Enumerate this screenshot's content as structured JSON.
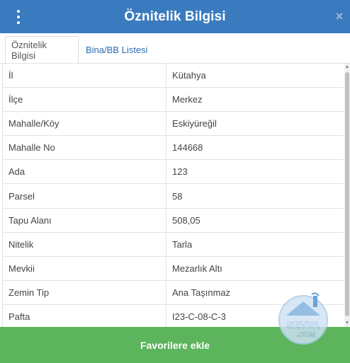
{
  "header": {
    "title": "Öznitelik Bilgisi",
    "menu_icon": "kebab-menu-icon",
    "close_icon": "close-icon",
    "close_glyph": "×"
  },
  "tabs": [
    {
      "label": "Öznitelik Bilgisi",
      "active": true
    },
    {
      "label": "Bina/BB Listesi",
      "active": false
    }
  ],
  "attributes": [
    {
      "key": "İl",
      "value": "Kütahya"
    },
    {
      "key": "İlçe",
      "value": "Merkez"
    },
    {
      "key": "Mahalle/Köy",
      "value": "Eskiyüreğil"
    },
    {
      "key": "Mahalle No",
      "value": "144668"
    },
    {
      "key": "Ada",
      "value": "123"
    },
    {
      "key": "Parsel",
      "value": "58"
    },
    {
      "key": "Tapu Alanı",
      "value": "508,05"
    },
    {
      "key": "Nitelik",
      "value": "Tarla"
    },
    {
      "key": "Mevkii",
      "value": "Mezarlık Altı"
    },
    {
      "key": "Zemin Tip",
      "value": "Ana Taşınmaz"
    },
    {
      "key": "Pafta",
      "value": "I23-C-08-C-3"
    }
  ],
  "footer": {
    "button_label": "Favorilere ekle"
  },
  "watermark": {
    "text_top": "SEVVA",
    "text_bottom": ".COM"
  },
  "colors": {
    "header_bg": "#3a7bbf",
    "tab_link": "#2c6db0",
    "footer_bg": "#5cb45c"
  }
}
